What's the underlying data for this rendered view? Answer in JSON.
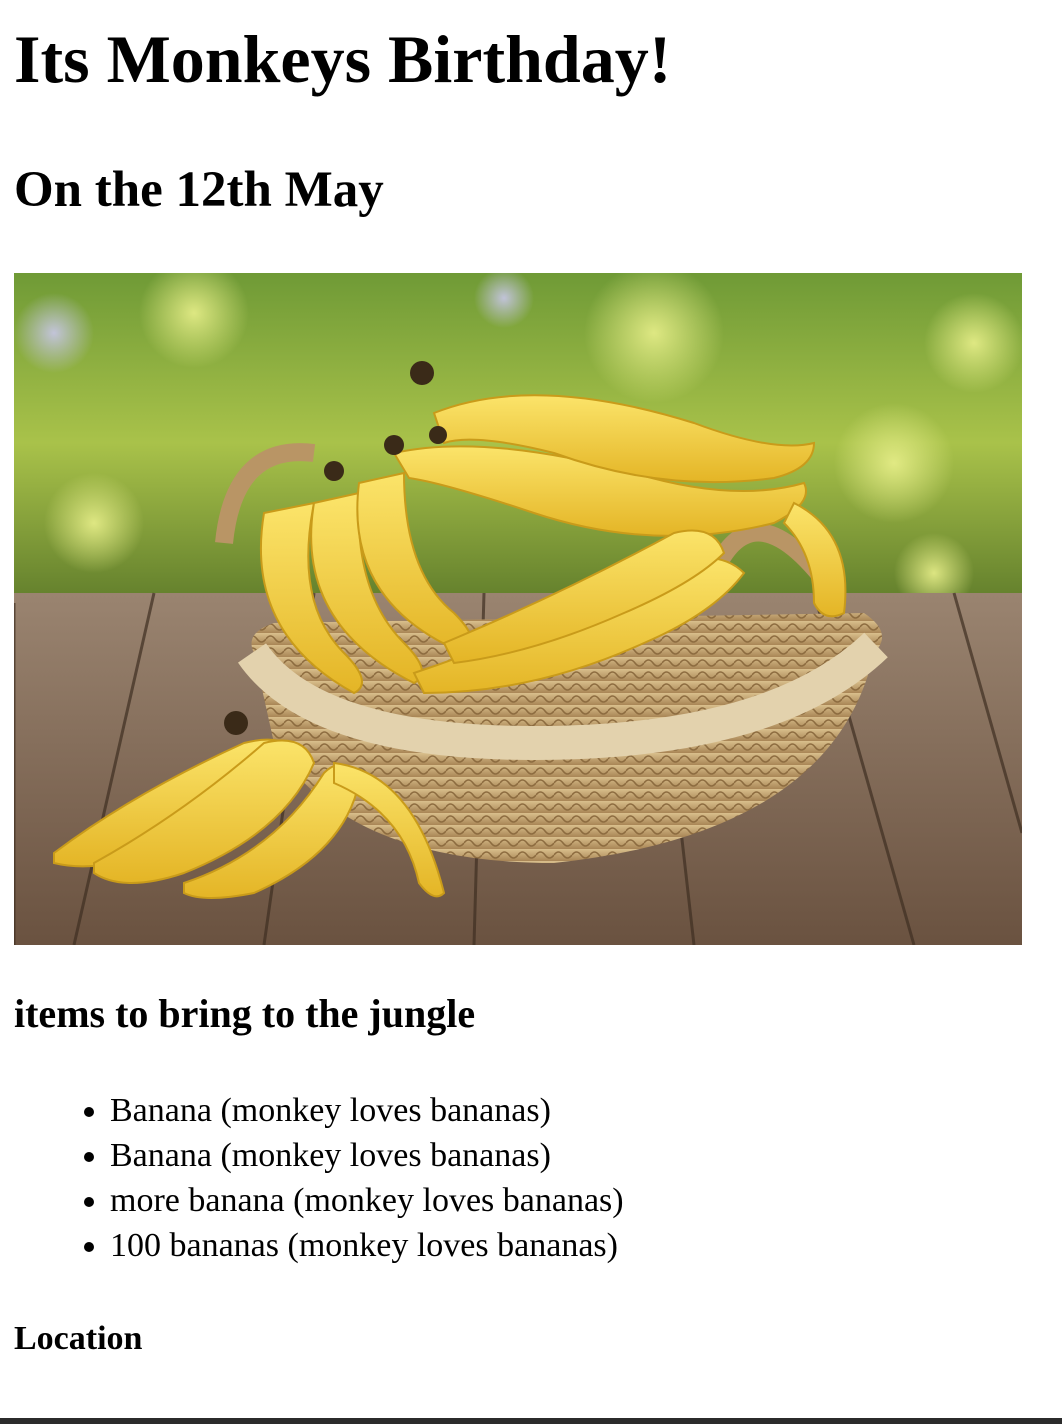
{
  "page": {
    "title": "Its Monkeys Birthday!",
    "date_heading": "On the 12th May",
    "items_heading": "items to bring to the jungle",
    "items": [
      "Banana (monkey loves bananas)",
      "Banana (monkey loves bananas)",
      "more banana (monkey loves bananas)",
      "100 bananas (monkey loves bananas)"
    ],
    "location_heading": "Location"
  },
  "image": {
    "subject": "bananas-in-wicker-basket"
  },
  "colors": {
    "banana_yellow": "#f3d03a",
    "basket_tan": "#c9a874",
    "table_wood": "#7f6650",
    "foliage_green": "#7fa63a"
  }
}
